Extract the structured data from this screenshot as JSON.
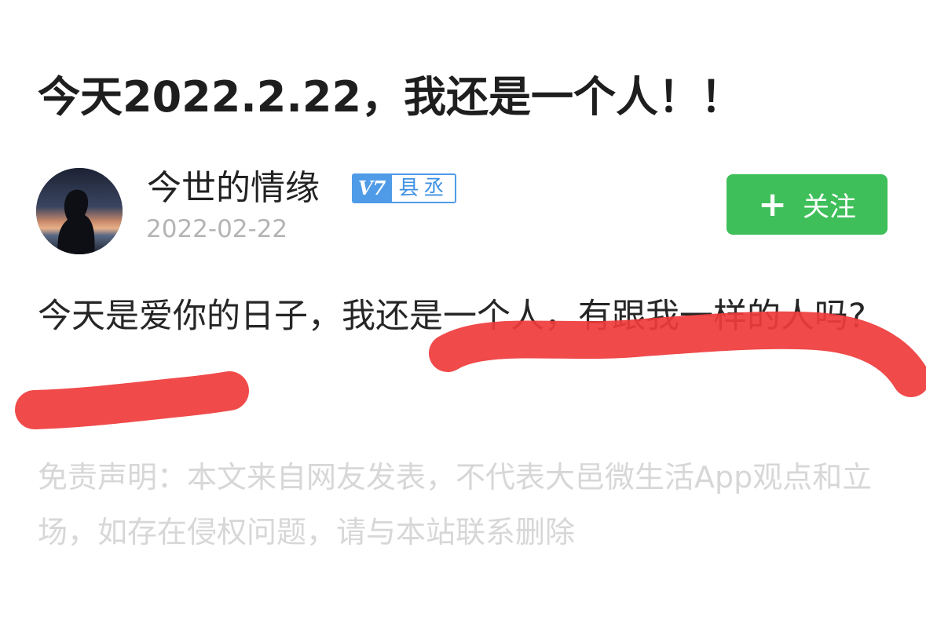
{
  "post": {
    "title": "今天2022.2.22，我还是一个人！！",
    "content": "今天是爱你的日子，我还是一个人，有跟我一样的人吗?",
    "disclaimer": "免责声明：本文来自网友发表，不代表大邑微生活App观点和立场，如存在侵权问题，请与本站联系删除"
  },
  "author": {
    "name": "今世的情缘",
    "date": "2022-02-22",
    "avatar_icon": "avatar-silhouette-photo",
    "badge": {
      "level": "V7",
      "title": "县丞",
      "color": "#4f9be8"
    }
  },
  "follow": {
    "label": "关注",
    "icon": "plus-icon",
    "color": "#3fbf5a"
  },
  "annotation": {
    "color": "#ef3b3b"
  }
}
